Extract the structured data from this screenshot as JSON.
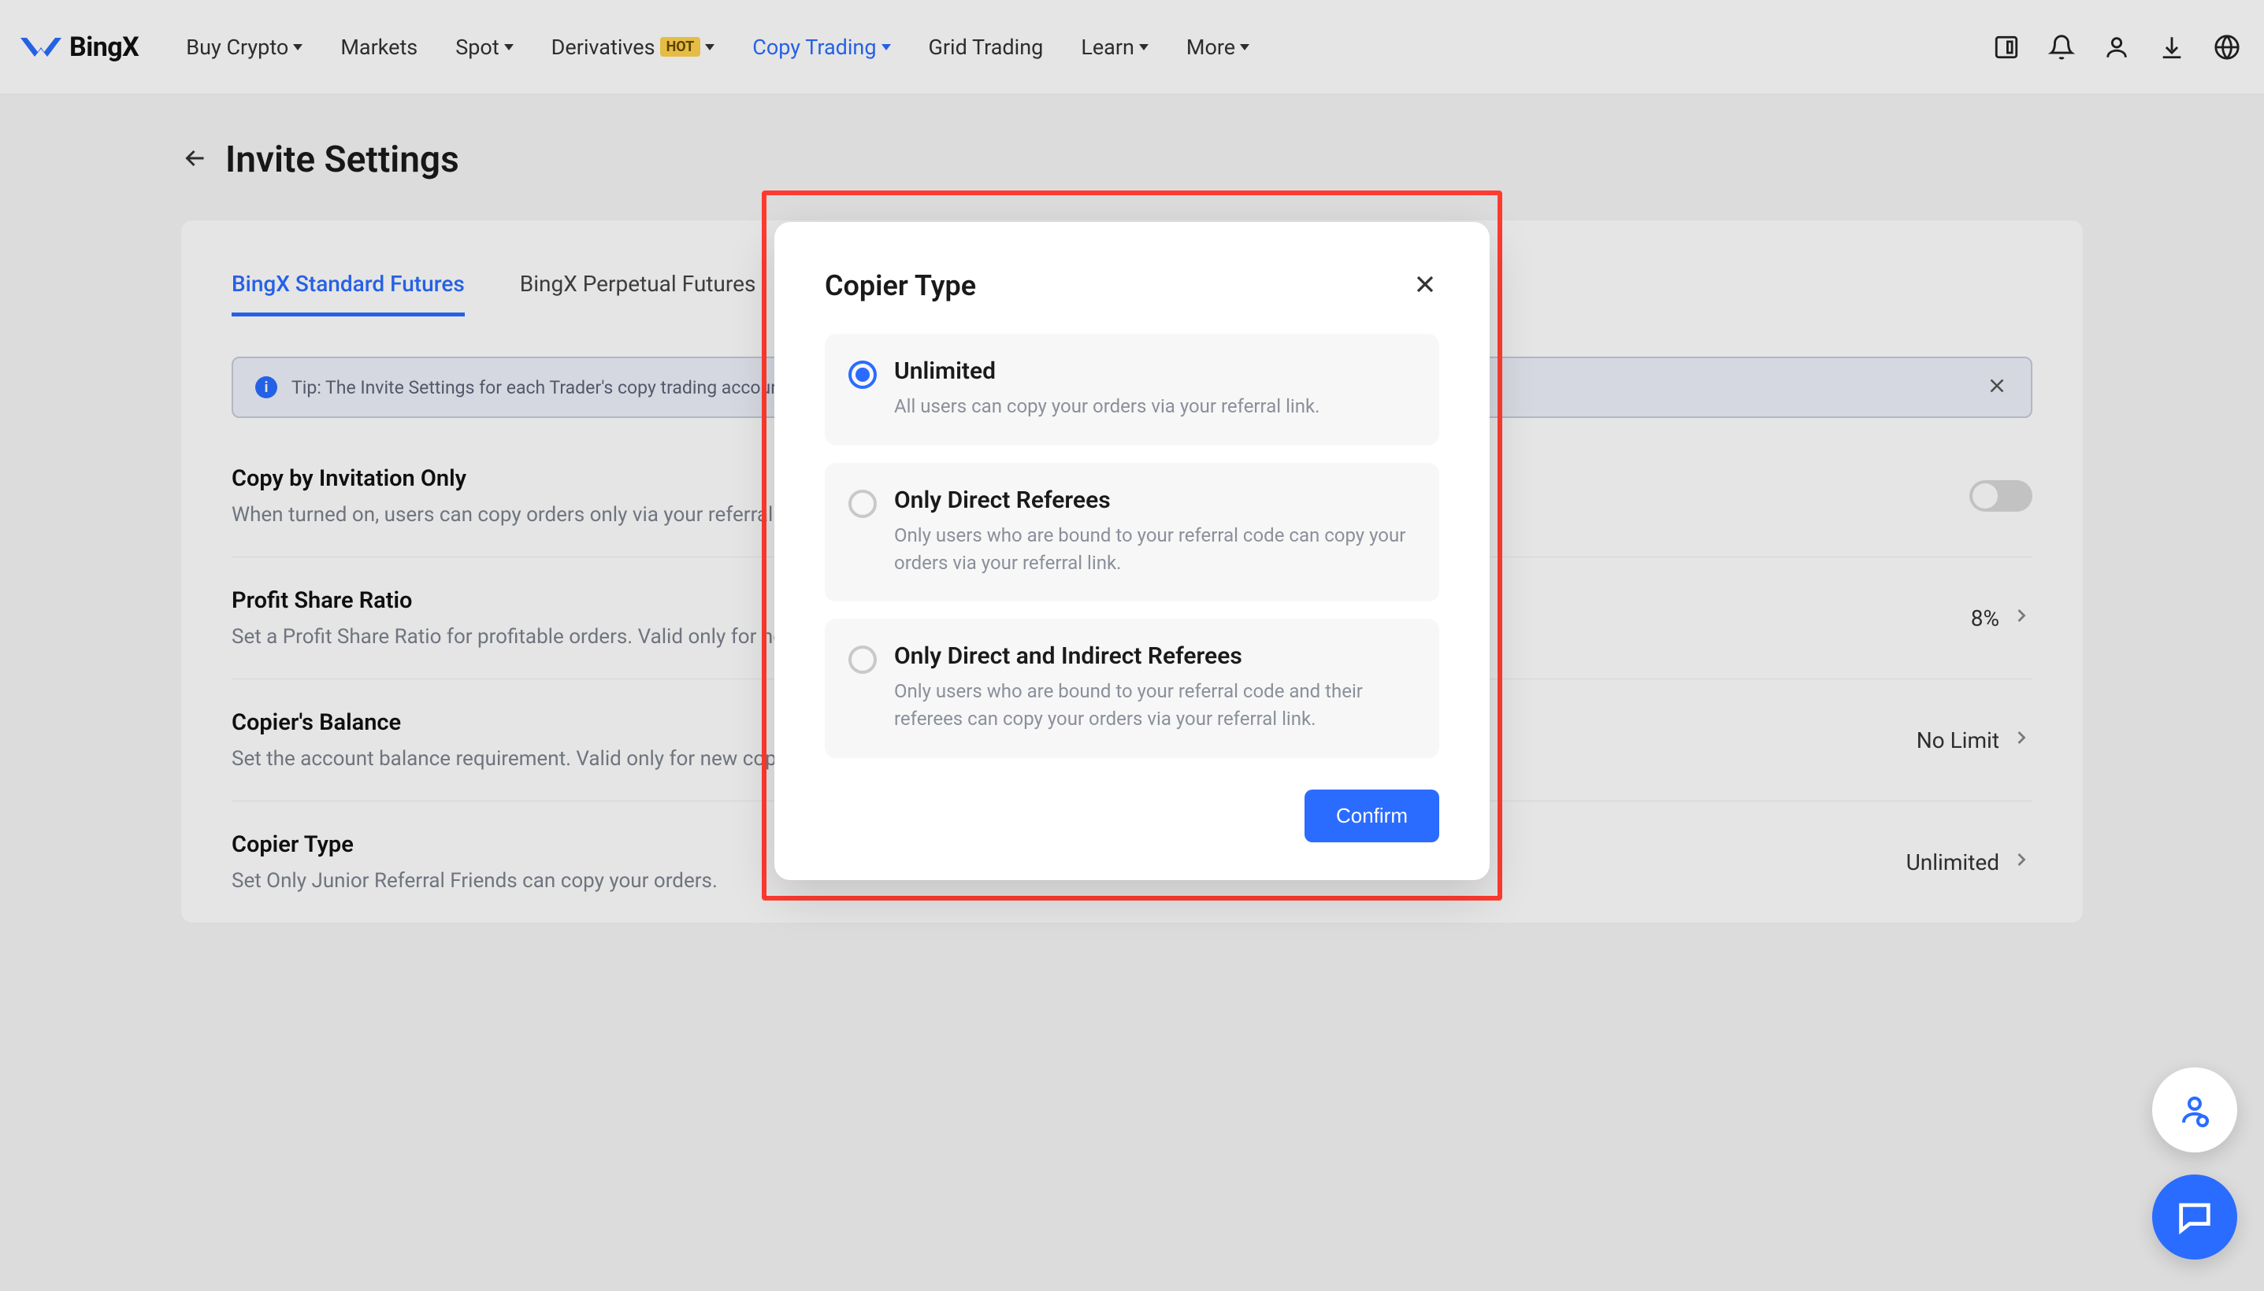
{
  "brand": "BingX",
  "nav": [
    {
      "label": "Buy Crypto",
      "dropdown": true,
      "badge": null,
      "active": false
    },
    {
      "label": "Markets",
      "dropdown": false,
      "badge": null,
      "active": false
    },
    {
      "label": "Spot",
      "dropdown": true,
      "badge": null,
      "active": false
    },
    {
      "label": "Derivatives",
      "dropdown": true,
      "badge": "HOT",
      "active": false
    },
    {
      "label": "Copy Trading",
      "dropdown": true,
      "badge": null,
      "active": true
    },
    {
      "label": "Grid Trading",
      "dropdown": false,
      "badge": null,
      "active": false
    },
    {
      "label": "Learn",
      "dropdown": true,
      "badge": null,
      "active": false
    },
    {
      "label": "More",
      "dropdown": true,
      "badge": null,
      "active": false
    }
  ],
  "page": {
    "title": "Invite Settings",
    "tabs": [
      {
        "label": "BingX Standard Futures",
        "selected": true
      },
      {
        "label": "BingX Perpetual Futures",
        "selected": false
      }
    ],
    "tip": "Tip: The Invite Settings for each Trader's copy trading account are independent.",
    "settings": [
      {
        "key": "invite_only",
        "title": "Copy by Invitation Only",
        "desc": "When turned on, users can copy orders only via your referral link.",
        "type": "toggle",
        "value": false
      },
      {
        "key": "profit_share",
        "title": "Profit Share Ratio",
        "desc": "Set a Profit Share Ratio for profitable orders. Valid only for new copiers.",
        "type": "nav",
        "value": "8%"
      },
      {
        "key": "copier_balance",
        "title": "Copier's Balance",
        "desc": "Set the account balance requirement. Valid only for new copiers.",
        "type": "nav",
        "value": "No Limit"
      },
      {
        "key": "copier_type",
        "title": "Copier Type",
        "desc": "Set Only Junior Referral Friends can copy your orders.",
        "type": "nav",
        "value": "Unlimited"
      }
    ]
  },
  "modal": {
    "title": "Copier Type",
    "confirm": "Confirm",
    "options": [
      {
        "title": "Unlimited",
        "desc": "All users can copy your orders via your referral link.",
        "selected": true
      },
      {
        "title": "Only Direct Referees",
        "desc": "Only users who are bound to your referral code can copy your orders via your referral link.",
        "selected": false
      },
      {
        "title": "Only Direct and Indirect Referees",
        "desc": "Only users who are bound to your referral code and their referees can copy your orders via your referral link.",
        "selected": false
      }
    ]
  }
}
